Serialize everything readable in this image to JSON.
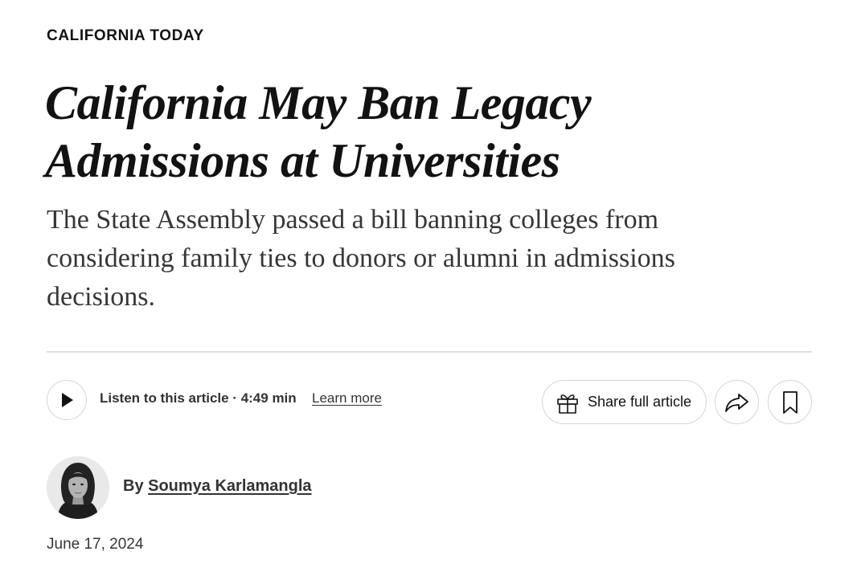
{
  "article": {
    "kicker": "CALIFORNIA TODAY",
    "headline": "California May Ban Legacy Admissions at Universities",
    "summary": "The State Assembly passed a bill banning colleges from considering family ties to donors or alumni in admissions decisions."
  },
  "audio": {
    "play_icon": "play-icon",
    "listen_text": "Listen to this article · 4:49 min",
    "learn_more": "Learn more"
  },
  "actions": {
    "share_full_label": "Share full article",
    "gift_icon": "gift-icon",
    "share_icon": "share-arrow-icon",
    "save_icon": "bookmark-icon"
  },
  "byline": {
    "prefix": "By ",
    "author": "Soumya Karlamangla",
    "avatar": "author-avatar"
  },
  "date": "June 17, 2024",
  "colors": {
    "text": "#121212",
    "summary": "#363636",
    "divider": "#dfdfdf",
    "border": "#d5d5d5"
  }
}
